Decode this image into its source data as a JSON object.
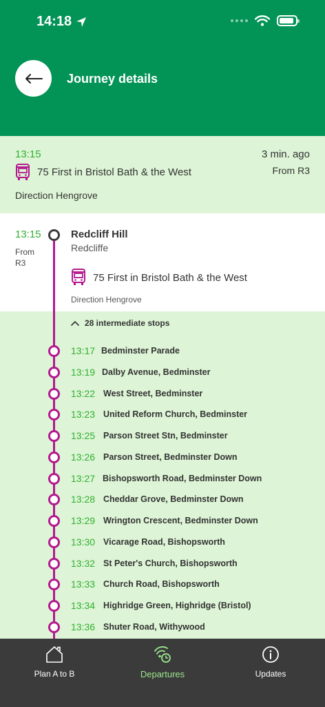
{
  "status": {
    "time": "14:18"
  },
  "header": {
    "title": "Journey details"
  },
  "summary": {
    "time": "13:15",
    "ago": "3 min. ago",
    "from": "From R3",
    "route": "75 First in Bristol Bath & the West",
    "direction": "Direction Hengrove"
  },
  "origin": {
    "time": "13:15",
    "from": "From R3",
    "name": "Redcliff Hill",
    "area": "Redcliffe",
    "route": "75 First in Bristol Bath & the West",
    "direction": "Direction Hengrove"
  },
  "intermediate_label": "28 intermediate stops",
  "stops": [
    {
      "time": "13:17",
      "name": "Bedminster Parade"
    },
    {
      "time": "13:19",
      "name": "Dalby Avenue, Bedminster"
    },
    {
      "time": "13:22",
      "name": "West Street, Bedminster"
    },
    {
      "time": "13:23",
      "name": "United Reform Church, Bedminster"
    },
    {
      "time": "13:25",
      "name": "Parson Street Stn, Bedminster"
    },
    {
      "time": "13:26",
      "name": "Parson Street, Bedminster Down"
    },
    {
      "time": "13:27",
      "name": "Bishopsworth Road, Bedminster Down"
    },
    {
      "time": "13:28",
      "name": "Cheddar Grove, Bedminster Down"
    },
    {
      "time": "13:29",
      "name": "Wrington Crescent, Bedminster Down"
    },
    {
      "time": "13:30",
      "name": "Vicarage Road, Bishopsworth"
    },
    {
      "time": "13:32",
      "name": "St Peter's Church, Bishopsworth"
    },
    {
      "time": "13:33",
      "name": "Church Road, Bishopsworth"
    },
    {
      "time": "13:34",
      "name": "Highridge Green, Highridge (Bristol)"
    },
    {
      "time": "13:36",
      "name": "Shuter Road, Withywood"
    }
  ],
  "tabs": [
    {
      "label": "Plan A to B",
      "icon": "house-icon"
    },
    {
      "label": "Departures",
      "icon": "departures-icon"
    },
    {
      "label": "Updates",
      "icon": "info-icon"
    }
  ],
  "colors": {
    "header": "#029356",
    "route_line": "#b3188e",
    "time_green": "#30b030",
    "tab_active": "#9be88e"
  }
}
